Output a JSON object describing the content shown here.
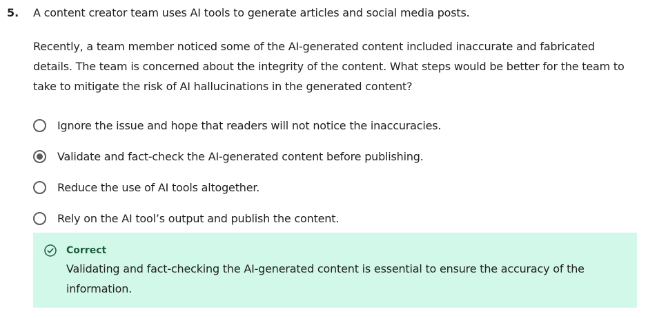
{
  "question": {
    "number": "5.",
    "intro": "A content creator team uses AI tools to generate articles and social media posts.",
    "prompt": "Recently, a team member noticed some of the AI-generated content included inaccurate and fabricated details. The team is concerned about the integrity of the content. What steps would be better for the team to take to mitigate the risk of AI hallucinations in the generated content?",
    "options": [
      {
        "label": "Ignore the issue and hope that readers will not notice the inaccuracies.",
        "selected": false
      },
      {
        "label": "Validate and fact-check the AI-generated content before publishing.",
        "selected": true
      },
      {
        "label": "Reduce the use of AI tools altogether.",
        "selected": false
      },
      {
        "label": "Rely on the AI tool’s output and publish the content.",
        "selected": false
      }
    ]
  },
  "feedback": {
    "status": "Correct",
    "icon": "check-circle-icon",
    "text": "Validating and fact-checking the AI-generated content is essential to ensure the accuracy of the information.",
    "accent_color": "#1c5c3a",
    "background_color": "#d2f8ea"
  }
}
